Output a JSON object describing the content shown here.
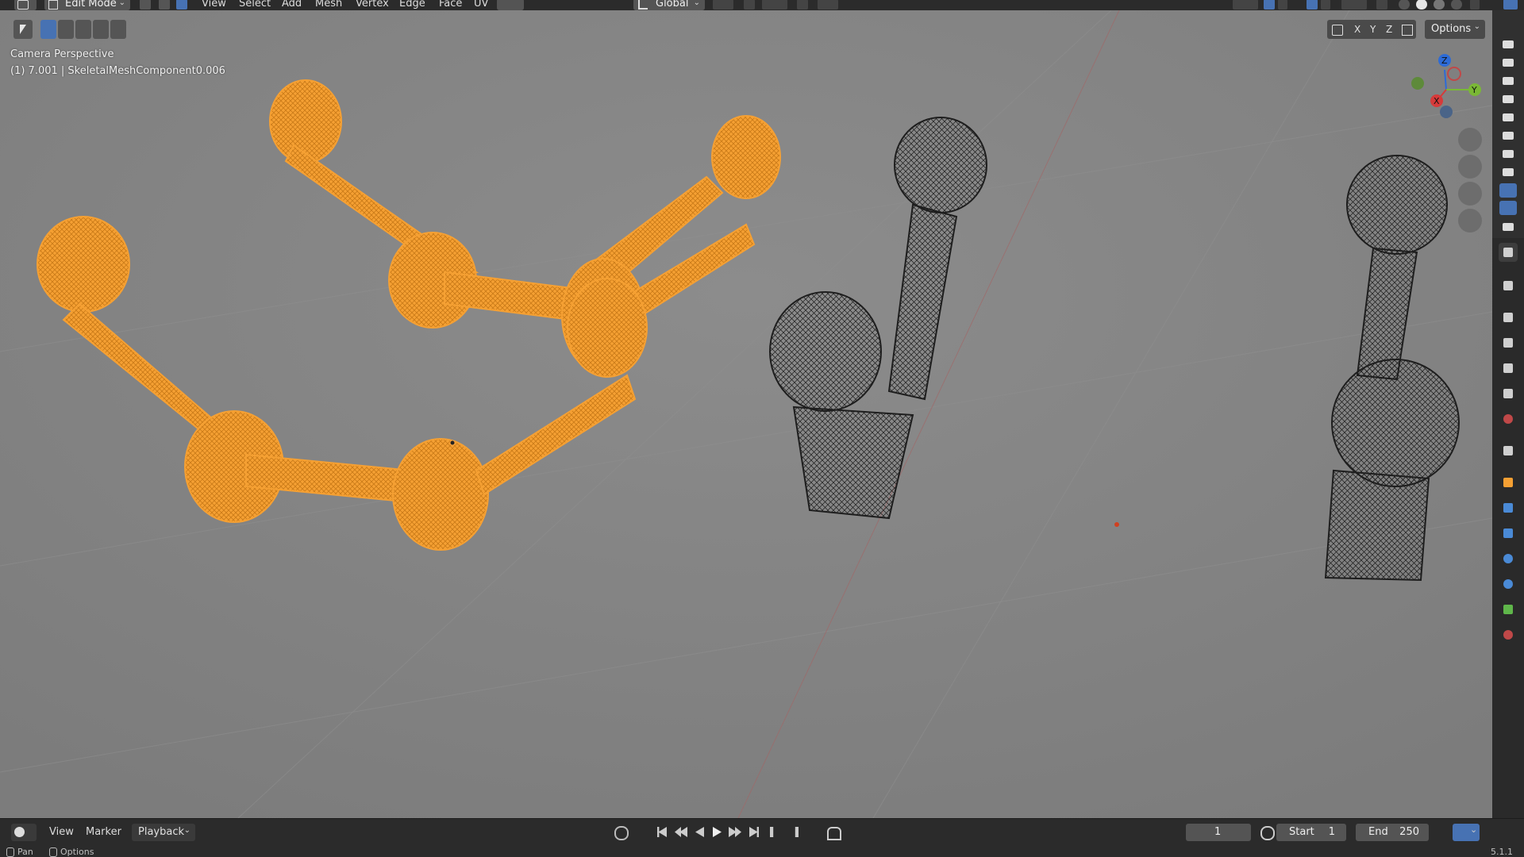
{
  "header": {
    "mode": "Edit Mode",
    "menus": [
      "View",
      "Select",
      "Add",
      "Mesh",
      "Vertex",
      "Edge",
      "Face",
      "UV"
    ],
    "orientation": "Global"
  },
  "viewport": {
    "perspective_label": "Camera Perspective",
    "object_info": "(1) 7.001 | SkeletalMeshComponent0.006",
    "options_label": "Options",
    "axis_x": "X",
    "axis_y": "Y",
    "axis_z": "Z",
    "gizmo_x": "X",
    "gizmo_y": "Y",
    "gizmo_z": "Z"
  },
  "timeline": {
    "view": "View",
    "marker": "Marker",
    "playback": "Playback",
    "current_frame": "1",
    "start_label": "Start",
    "start_value": "1",
    "end_label": "End",
    "end_value": "250"
  },
  "statusbar": {
    "pan": "Pan",
    "options": "Options",
    "version": "5.1.1"
  },
  "colors": {
    "selected_orange": "#f5a033",
    "wire_dark": "#1a1a1a",
    "accent_blue": "#4772b3",
    "viewport_bg": "#848484"
  }
}
